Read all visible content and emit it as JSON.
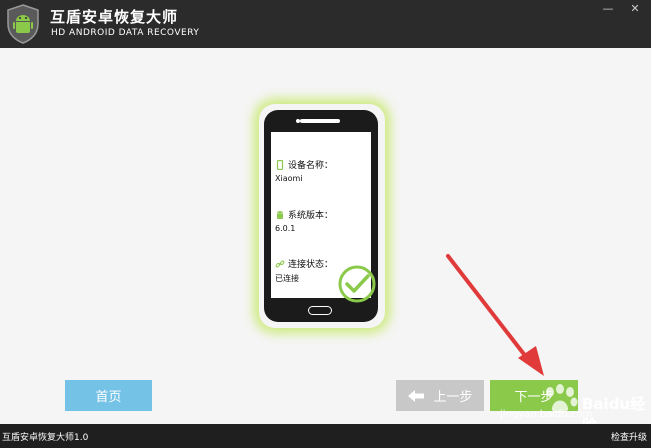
{
  "app": {
    "title": "互盾安卓恢复大师",
    "subtitle": "HD ANDROID DATA RECOVERY",
    "minimize_label": "—",
    "close_label": "✕"
  },
  "device": {
    "name_label": "设备名称：",
    "name_value": "Xiaomi",
    "version_label": "系统版本：",
    "version_value": "6.0.1",
    "status_label": "连接状态：",
    "status_value": "已连接"
  },
  "buttons": {
    "home": "首页",
    "prev": "上一步",
    "next": "下一步"
  },
  "watermark": {
    "text": "Baidu经验",
    "url": "jingyan.baidu.com"
  },
  "statusbar": {
    "version": "互盾安卓恢复大师1.0",
    "check_update": "检查升级"
  },
  "colors": {
    "accent_green": "#8bc94a",
    "home_blue": "#74c2e6",
    "titlebar": "#2b2b2b",
    "arrow_red": "#e03a3a"
  }
}
